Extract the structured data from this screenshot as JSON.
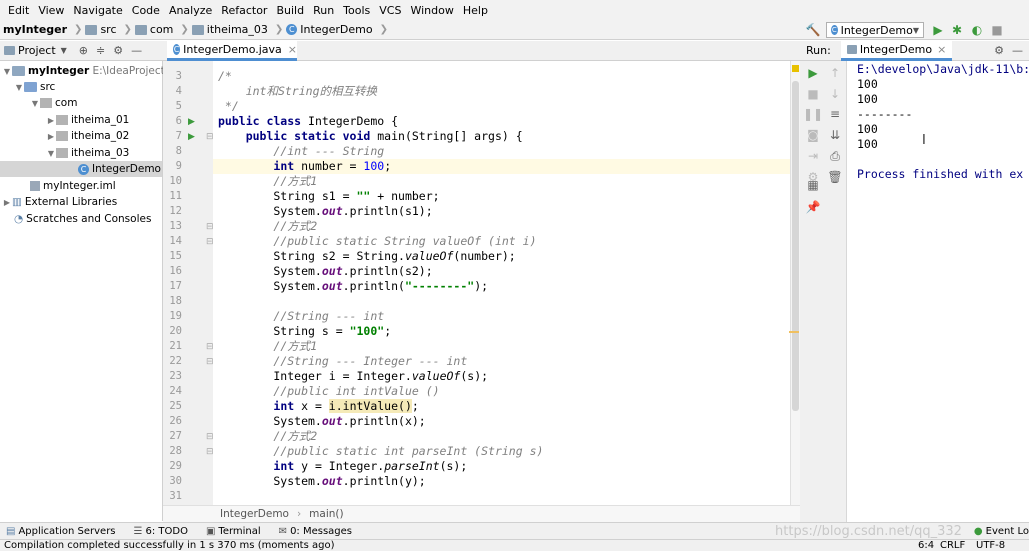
{
  "menu": [
    "Edit",
    "View",
    "Navigate",
    "Code",
    "Analyze",
    "Refactor",
    "Build",
    "Run",
    "Tools",
    "VCS",
    "Window",
    "Help"
  ],
  "breadcrumb": {
    "project": "myInteger",
    "src": "src",
    "com": "com",
    "pkg": "itheima_03",
    "cls": "IntegerDemo"
  },
  "run_config": "IntegerDemo",
  "project_panel": {
    "label": "Project"
  },
  "tree": {
    "root": "myInteger",
    "root_path": "E:\\IdeaProjects\\Ja",
    "src": "src",
    "com": "com",
    "p1": "itheima_01",
    "p2": "itheima_02",
    "p3": "itheima_03",
    "cls": "IntegerDemo",
    "iml": "myInteger.iml",
    "ext": "External Libraries",
    "scratch": "Scratches and Consoles"
  },
  "editor": {
    "tab": "IntegerDemo.java",
    "crumb1": "IntegerDemo",
    "crumb2": "main()"
  },
  "line_numbers": [
    "3",
    "4",
    "5",
    "6",
    "7",
    "8",
    "9",
    "10",
    "11",
    "12",
    "13",
    "14",
    "15",
    "16",
    "17",
    "18",
    "19",
    "20",
    "21",
    "22",
    "23",
    "24",
    "25",
    "26",
    "27",
    "28",
    "29",
    "30",
    "31"
  ],
  "run_panel": {
    "label": "Run:",
    "tab": "IntegerDemo"
  },
  "console": [
    "E:\\develop\\Java\\jdk-11\\b:",
    "100",
    "100",
    "--------",
    "100",
    "100",
    "",
    "Process finished with ex"
  ],
  "tool_windows": {
    "app_servers": "Application Servers",
    "todo": "6: TODO",
    "terminal": "Terminal",
    "messages": "0: Messages",
    "event_log": "Event Lo"
  },
  "watermark": "https://blog.csdn.net/qq_332",
  "status": {
    "text": "Compilation completed successfully in 1 s 370 ms (moments ago)",
    "pos": "6:4",
    "crlf": "CRLF",
    "enc": "UTF-8"
  },
  "colors": {
    "keyword": "#000080",
    "comment": "#808080",
    "string": "#008000",
    "number": "#0000ff",
    "accent": "#4e8ed1",
    "run_green": "#3c9a3c"
  }
}
